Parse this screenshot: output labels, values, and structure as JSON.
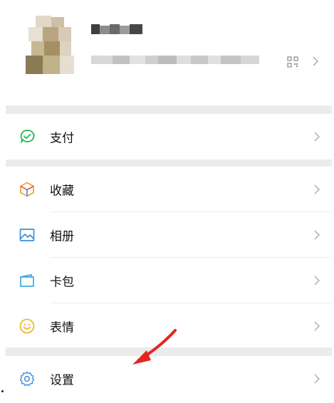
{
  "menu": {
    "pay_label": "支付",
    "favorites_label": "收藏",
    "album_label": "相册",
    "card_label": "卡包",
    "stickers_label": "表情",
    "settings_label": "设置"
  },
  "colors": {
    "pay_icon": "#27b45a",
    "favorites_icon_a": "#f0a23a",
    "favorites_icon_b": "#3b8fe0",
    "album_icon": "#3b8fe0",
    "card_icon": "#3aa7e3",
    "stickers_icon": "#f0b429",
    "settings_icon": "#3b8fe0",
    "annotation_arrow": "#e52620"
  }
}
